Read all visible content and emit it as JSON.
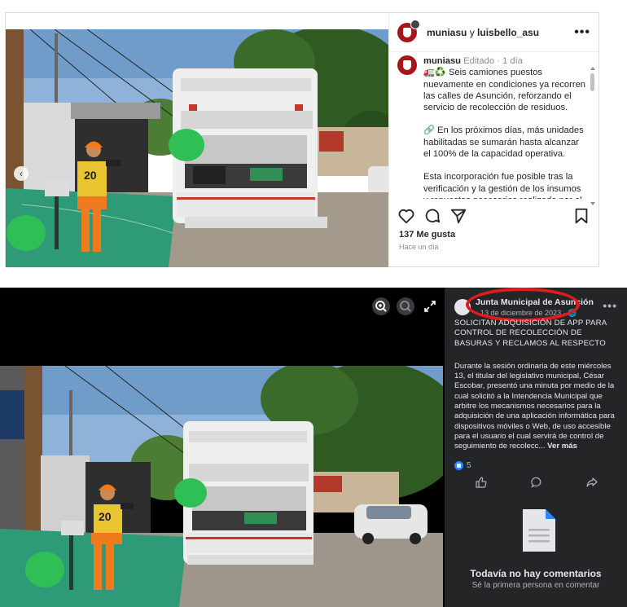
{
  "instagram": {
    "header_user": "muniasu",
    "header_connector": "y",
    "header_coauthor": "luisbello_asu",
    "caption_user": "muniasu",
    "caption_meta": "Editado · 1 día",
    "caption_p1": "🚛♻️ Seis camiones puestos nuevamente en condiciones ya recorren las calles de Asunción, reforzando el servicio de recolección de residuos.",
    "caption_p2": "🔗 En los próximos días, más unidades habilitadas se sumarán hasta alcanzar el 100% de la capacidad operativa.",
    "caption_p3": "Esta incorporación fue posible tras la verificación y la gestión de los insumos y repuestos necesarios realizada por el",
    "likes": "137 Me gusta",
    "time": "Hace un día",
    "more_label": "•••",
    "prev_label": "‹"
  },
  "facebook": {
    "page_name": "Junta Municipal de Asunción",
    "date": "13 de diciembre de 2023 · 🌐",
    "more_label": "•••",
    "title": "SOLICITAN ADQUISICIÓN DE APP PARA CONTROL DE RECOLECCIÓN DE BASURAS Y RECLAMOS AL RESPECTO",
    "body": "Durante la sesión ordinaria de este miércoles 13, el titular del legislativo municipal, César Escobar, presentó una minuta por medio de la cual solicitó a la Intendencia Municipal que arbitre los mecanismos necesarios para la adquisición de una aplicación informática para dispositivos móviles o Web, de uso accesible para el usuario el cual servirá de control de seguimiento de recolecc...",
    "see_more": "Ver más",
    "reactions_count": "5",
    "no_comments": "Todavía no hay comentarios",
    "be_first": "Sé la primera persona en comentar"
  },
  "colors": {
    "annotation_circle": "#e01b1b",
    "fb_panel": "#242526",
    "ig_shield": "#a5161b"
  },
  "icons": [
    "heart-icon",
    "comment-icon",
    "share-icon",
    "bookmark-icon",
    "zoom-in-icon",
    "zoom-out-icon",
    "fullscreen-icon",
    "like-icon",
    "document-icon"
  ]
}
